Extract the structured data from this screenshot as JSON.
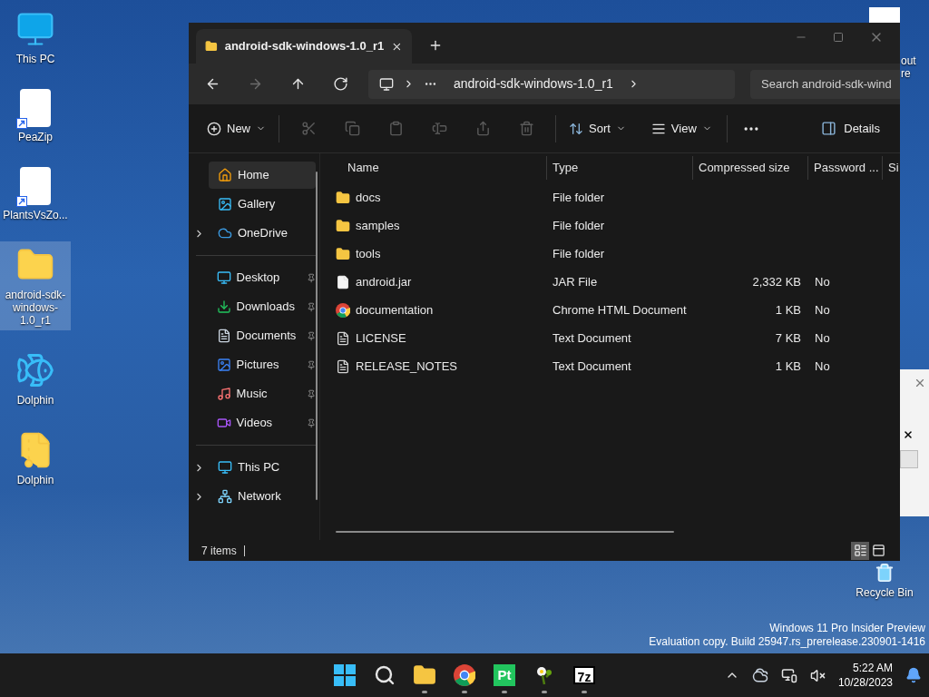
{
  "desktop": {
    "icons": [
      {
        "label": "This PC",
        "kind": "monitor",
        "selected": false
      },
      {
        "label": "PeaZip",
        "kind": "shortcut",
        "selected": false
      },
      {
        "label": "PlantsVsZo...",
        "kind": "shortcut",
        "selected": false
      },
      {
        "label": "android-sdk-windows-1.0_r1",
        "kind": "folder",
        "selected": true
      },
      {
        "label": "Dolphin",
        "kind": "dolphin",
        "selected": false
      },
      {
        "label": "Dolphin",
        "kind": "zip",
        "selected": false
      }
    ],
    "partial_label": [
      "out",
      "re"
    ],
    "recycle_bin": {
      "label": "Recycle Bin"
    },
    "watermark": [
      "Windows 11 Pro Insider Preview",
      "Evaluation copy. Build 25947.rs_prerelease.230901-1416"
    ]
  },
  "window": {
    "tab": {
      "title": "android-sdk-windows-1.0_r1"
    },
    "address": {
      "crumb": "android-sdk-windows-1.0_r1"
    },
    "search": {
      "placeholder": "Search android-sdk-wind"
    },
    "nav": [
      {
        "kind": "back",
        "disabled": false
      },
      {
        "kind": "forward",
        "disabled": true
      },
      {
        "kind": "up",
        "disabled": false
      },
      {
        "kind": "refresh",
        "disabled": false
      }
    ],
    "toolbar": {
      "new": "New",
      "actions": [
        {
          "kind": "cut",
          "disabled": true
        },
        {
          "kind": "copy",
          "disabled": true
        },
        {
          "kind": "paste",
          "disabled": true
        },
        {
          "kind": "rename",
          "disabled": true
        },
        {
          "kind": "share",
          "disabled": true
        },
        {
          "kind": "delete",
          "disabled": true
        }
      ],
      "sort": "Sort",
      "view": "View",
      "details": "Details"
    },
    "sidebar": {
      "sections": [
        [
          {
            "label": "Home",
            "kind": "home",
            "selected": true,
            "expandable": false,
            "pinned": false
          },
          {
            "label": "Gallery",
            "kind": "gallery",
            "selected": false,
            "expandable": false,
            "pinned": false
          },
          {
            "label": "OneDrive",
            "kind": "cloud",
            "selected": false,
            "expandable": true,
            "pinned": false
          }
        ],
        [
          {
            "label": "Desktop",
            "kind": "desktop",
            "selected": false,
            "expandable": false,
            "pinned": true
          },
          {
            "label": "Downloads",
            "kind": "downloads",
            "selected": false,
            "expandable": false,
            "pinned": true
          },
          {
            "label": "Documents",
            "kind": "documents",
            "selected": false,
            "expandable": false,
            "pinned": true
          },
          {
            "label": "Pictures",
            "kind": "pictures",
            "selected": false,
            "expandable": false,
            "pinned": true
          },
          {
            "label": "Music",
            "kind": "music",
            "selected": false,
            "expandable": false,
            "pinned": true
          },
          {
            "label": "Videos",
            "kind": "videos",
            "selected": false,
            "expandable": false,
            "pinned": true
          }
        ],
        [
          {
            "label": "This PC",
            "kind": "pc",
            "selected": false,
            "expandable": true,
            "pinned": false
          },
          {
            "label": "Network",
            "kind": "network",
            "selected": false,
            "expandable": true,
            "pinned": false
          }
        ]
      ]
    },
    "table": {
      "columns": [
        "Name",
        "Type",
        "Compressed size",
        "Password ...",
        "Si"
      ],
      "rows": [
        {
          "name": "docs",
          "kind": "folder",
          "type": "File folder",
          "size": "",
          "password": ""
        },
        {
          "name": "samples",
          "kind": "folder",
          "type": "File folder",
          "size": "",
          "password": ""
        },
        {
          "name": "tools",
          "kind": "folder",
          "type": "File folder",
          "size": "",
          "password": ""
        },
        {
          "name": "android.jar",
          "kind": "file",
          "type": "JAR File",
          "size": "2,332 KB",
          "password": "No"
        },
        {
          "name": "documentation",
          "kind": "chrome",
          "type": "Chrome HTML Document",
          "size": "1 KB",
          "password": "No"
        },
        {
          "name": "LICENSE",
          "kind": "text",
          "type": "Text Document",
          "size": "7 KB",
          "password": "No"
        },
        {
          "name": "RELEASE_NOTES",
          "kind": "text",
          "type": "Text Document",
          "size": "1 KB",
          "password": "No"
        }
      ]
    },
    "status_bar": {
      "count": "7 items",
      "views": [
        {
          "kind": "details",
          "selected": true
        },
        {
          "kind": "tiles",
          "selected": false
        }
      ]
    }
  },
  "taskbar": {
    "apps": [
      {
        "kind": "start",
        "running": false
      },
      {
        "kind": "search",
        "running": false
      },
      {
        "kind": "explorer",
        "running": true
      },
      {
        "kind": "chrome",
        "running": true
      },
      {
        "kind": "pt",
        "running": true,
        "logo": "Pt"
      },
      {
        "kind": "plant",
        "running": true
      },
      {
        "kind": "sevenzip",
        "running": true,
        "logo": "7z"
      }
    ],
    "time": "5:22 AM",
    "date": "10/28/2023"
  }
}
